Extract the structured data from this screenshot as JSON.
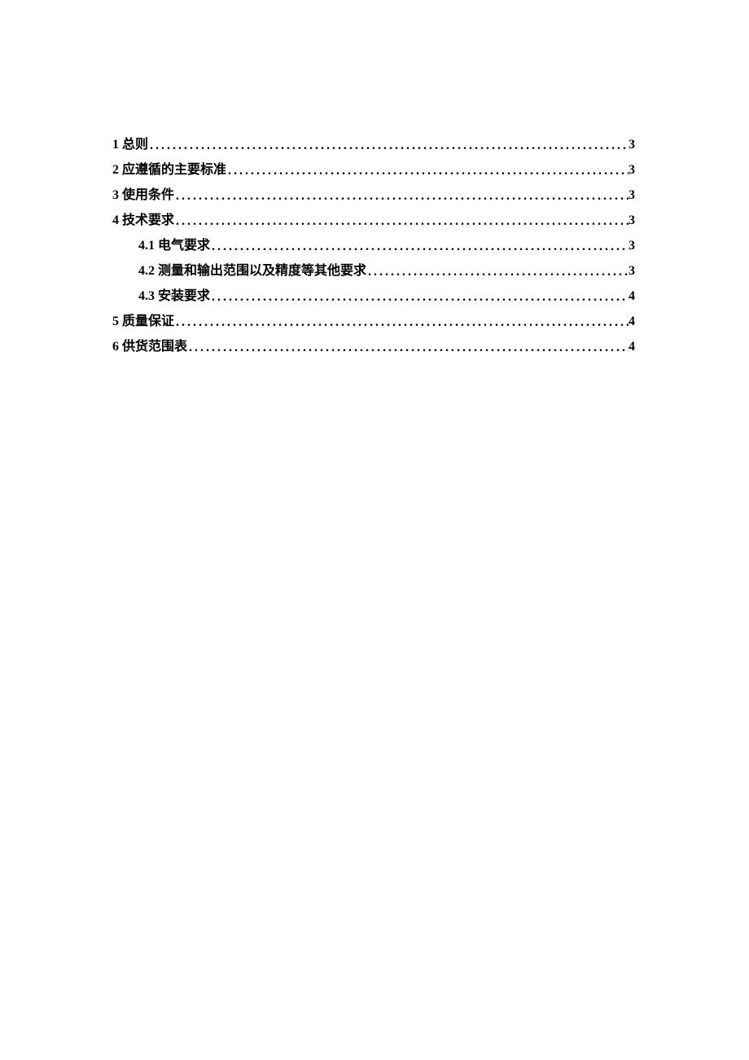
{
  "toc": [
    {
      "num": "1",
      "text": "总则",
      "page": "3",
      "indent": false
    },
    {
      "num": "2",
      "text": "应遵循的主要标准",
      "page": "3",
      "indent": false
    },
    {
      "num": "3",
      "text": "使用条件",
      "page": "3",
      "indent": false
    },
    {
      "num": "4",
      "text": "技术要求",
      "page": "3",
      "indent": false
    },
    {
      "num": "4.1",
      "text": "电气要求",
      "page": "3",
      "indent": true
    },
    {
      "num": "4.2",
      "text": "测量和输出范围以及精度等其他要求",
      "page": "3",
      "indent": true
    },
    {
      "num": "4.3",
      "text": "安装要求",
      "page": "4",
      "indent": true
    },
    {
      "num": "5",
      "text": "质量保证",
      "page": "4",
      "indent": false
    },
    {
      "num": "6",
      "text": "供货范围表",
      "page": "4",
      "indent": false
    }
  ]
}
